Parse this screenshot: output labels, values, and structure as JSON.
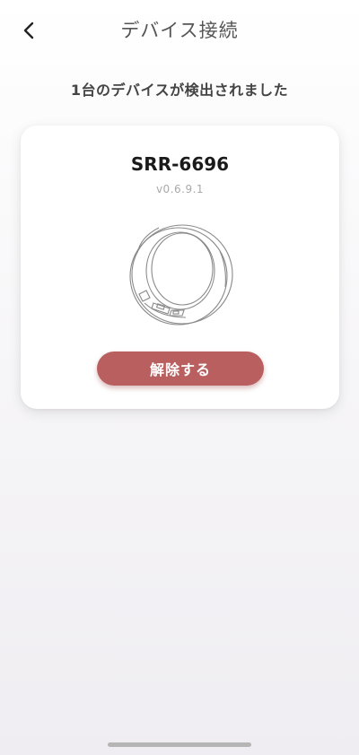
{
  "header": {
    "title": "デバイス接続",
    "back_icon": "chevron-left-icon"
  },
  "detect_message": "1台のデバイスが検出されました",
  "device": {
    "name": "SRR-6696",
    "version": "v0.6.9.1",
    "image_icon": "ring-icon"
  },
  "actions": {
    "release_label": "解除する"
  },
  "colors": {
    "button_bg": "#b95f5f",
    "card_bg": "#ffffff",
    "title_text": "#555555"
  }
}
